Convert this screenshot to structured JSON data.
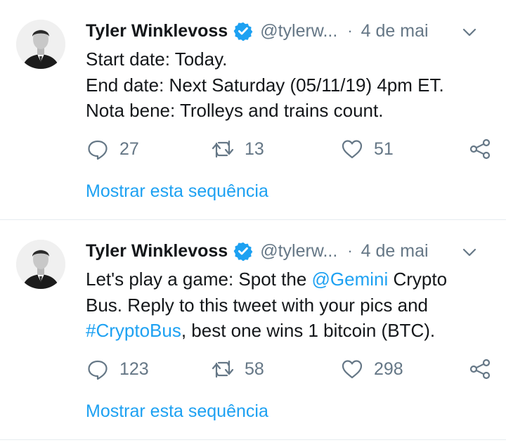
{
  "tweets": [
    {
      "name": "Tyler Winklevoss",
      "handle": "@tylerw...",
      "separator": "·",
      "date": "4 de mai",
      "lines": [
        "Start date: Today.",
        "End date: Next Saturday (05/11/19) 4pm ET.",
        "Nota bene: Trolleys and trains count."
      ],
      "reply_count": "27",
      "retweet_count": "13",
      "like_count": "51",
      "thread_link": "Mostrar esta sequência"
    },
    {
      "name": "Tyler Winklevoss",
      "handle": "@tylerw...",
      "separator": "·",
      "date": "4 de mai",
      "line1_a": "Let's play a game: Spot the ",
      "line1_mention": "@Gemini",
      "line1_b": " Crypto",
      "line2": "Bus. Reply to this tweet with your pics and",
      "line3_hashtag": "#CryptoBus",
      "line3_b": ", best one wins 1 bitcoin (BTC).",
      "reply_count": "123",
      "retweet_count": "58",
      "like_count": "298",
      "thread_link": "Mostrar esta sequência"
    }
  ],
  "colors": {
    "link": "#1da1f2",
    "muted": "#657786",
    "text": "#14171a",
    "divider": "#e6ecf0"
  },
  "icons": [
    "avatar",
    "verified-badge-icon",
    "chevron-down-icon",
    "reply-icon",
    "retweet-icon",
    "like-icon",
    "share-icon"
  ]
}
